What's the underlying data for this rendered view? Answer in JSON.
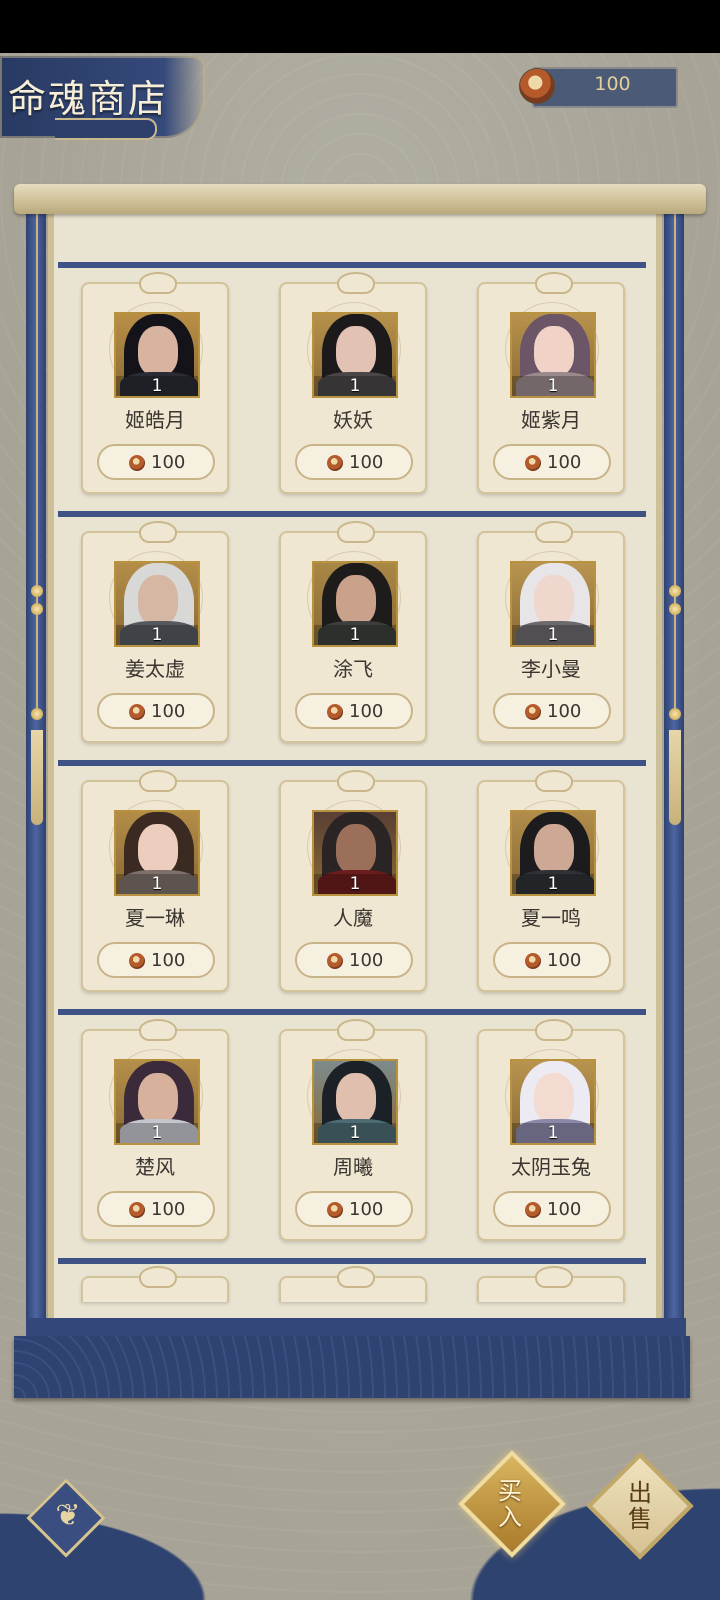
{
  "shop": {
    "title": "命魂商店"
  },
  "currency": {
    "icon": "soul-coin-icon",
    "value": "100"
  },
  "items": [
    {
      "name": "姬皓月",
      "level": "1",
      "price": "100",
      "hair": "#15131a",
      "skin": "#d8b3a0",
      "body": "#2a2b33",
      "bg": "#b98f46"
    },
    {
      "name": "妖妖",
      "level": "1",
      "price": "100",
      "hair": "#1d1a1c",
      "skin": "#e2c2b3",
      "body": "#4a4647",
      "bg": "#b6914b"
    },
    {
      "name": "姬紫月",
      "level": "1",
      "price": "100",
      "hair": "#6b5566",
      "skin": "#f0d2c6",
      "body": "#9a8a8e",
      "bg": "#b8924c"
    },
    {
      "name": "姜太虚",
      "level": "1",
      "price": "100",
      "hair": "#d8d8d6",
      "skin": "#d6b7a4",
      "body": "#55595f",
      "bg": "#b48d48"
    },
    {
      "name": "涂飞",
      "level": "1",
      "price": "100",
      "hair": "#1e1b1b",
      "skin": "#caa18a",
      "body": "#3c3f3c",
      "bg": "#a98745"
    },
    {
      "name": "李小曼",
      "level": "1",
      "price": "100",
      "hair": "#e7e5e8",
      "skin": "#f0d7cd",
      "body": "#6c6a6d",
      "bg": "#b89550"
    },
    {
      "name": "夏一琳",
      "level": "1",
      "price": "100",
      "hair": "#3b2a22",
      "skin": "#edcdbd",
      "body": "#7d6f6a",
      "bg": "#b38c47"
    },
    {
      "name": "人魔",
      "level": "1",
      "price": "100",
      "hair": "#2a2424",
      "skin": "#9c6f5a",
      "body": "#6b1c1c",
      "bg": "#5a3f35"
    },
    {
      "name": "夏一鸣",
      "level": "1",
      "price": "100",
      "hair": "#1c1b1d",
      "skin": "#cda895",
      "body": "#2f3136",
      "bg": "#b18c4a"
    },
    {
      "name": "楚风",
      "level": "1",
      "price": "100",
      "hair": "#3a2a3a",
      "skin": "#d7b19c",
      "body": "#c3c6cc",
      "bg": "#b48f4b"
    },
    {
      "name": "周曦",
      "level": "1",
      "price": "100",
      "hair": "#1b2127",
      "skin": "#e0bfae",
      "body": "#4d6b73",
      "bg": "#7d8b8c"
    },
    {
      "name": "太阴玉兔",
      "level": "1",
      "price": "100",
      "hair": "#ecebf3",
      "skin": "#f3dbd2",
      "body": "#8b87a8",
      "bg": "#b8944f"
    }
  ],
  "actions": {
    "buy_label": "买入",
    "sell_label": "出售"
  },
  "icons": {
    "back": "back-swirl-icon",
    "price": "soul-coin-icon"
  }
}
